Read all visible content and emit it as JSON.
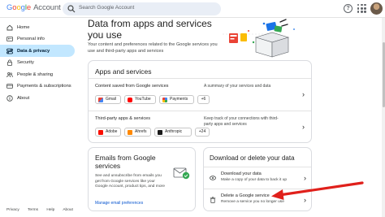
{
  "header": {
    "logo_google": "Google",
    "logo_account": "Account",
    "search_placeholder": "Search Google Account"
  },
  "sidebar": {
    "items": [
      {
        "label": "Home",
        "icon": "home-icon"
      },
      {
        "label": "Personal info",
        "icon": "person-card-icon"
      },
      {
        "label": "Data & privacy",
        "icon": "toggle-icon",
        "active": true
      },
      {
        "label": "Security",
        "icon": "lock-icon"
      },
      {
        "label": "People & sharing",
        "icon": "people-icon"
      },
      {
        "label": "Payments & subscriptions",
        "icon": "credit-card-icon"
      },
      {
        "label": "About",
        "icon": "info-icon"
      }
    ]
  },
  "main": {
    "title": "Data from apps and services you use",
    "description": "Your content and preferences related to the Google services you use and third-party apps and services",
    "apps_card": {
      "title": "Apps and services",
      "content_row": {
        "label": "Content saved from Google services",
        "note": "A summary of your services and data",
        "chips": [
          "Gmail",
          "YouTube",
          "Payments",
          "+6"
        ]
      },
      "third_party_row": {
        "label": "Third-party apps & services",
        "note": "Keep track of your connections with third-party apps and services",
        "chips": [
          "Adobe",
          "Ahrefs",
          "Anthropic",
          "+24"
        ]
      }
    },
    "emails_card": {
      "title": "Emails from Google services",
      "description": "See and unsubscribe from emails you get from Google services like your Google Account, product tips, and more",
      "link": "Manage email preferences"
    },
    "download_card": {
      "title": "Download or delete your data",
      "download_title": "Download your data",
      "download_desc": "Make a copy of your data to back it up",
      "delete_title": "Delete a Google service",
      "delete_desc": "Remove a service you no longer use"
    }
  },
  "footer": {
    "links": [
      "Privacy",
      "Terms",
      "Help",
      "About"
    ]
  },
  "colors": {
    "active_nav_bg": "#c2e7ff",
    "link_blue": "#0b57d0",
    "annotation_arrow": "#e0201b"
  }
}
